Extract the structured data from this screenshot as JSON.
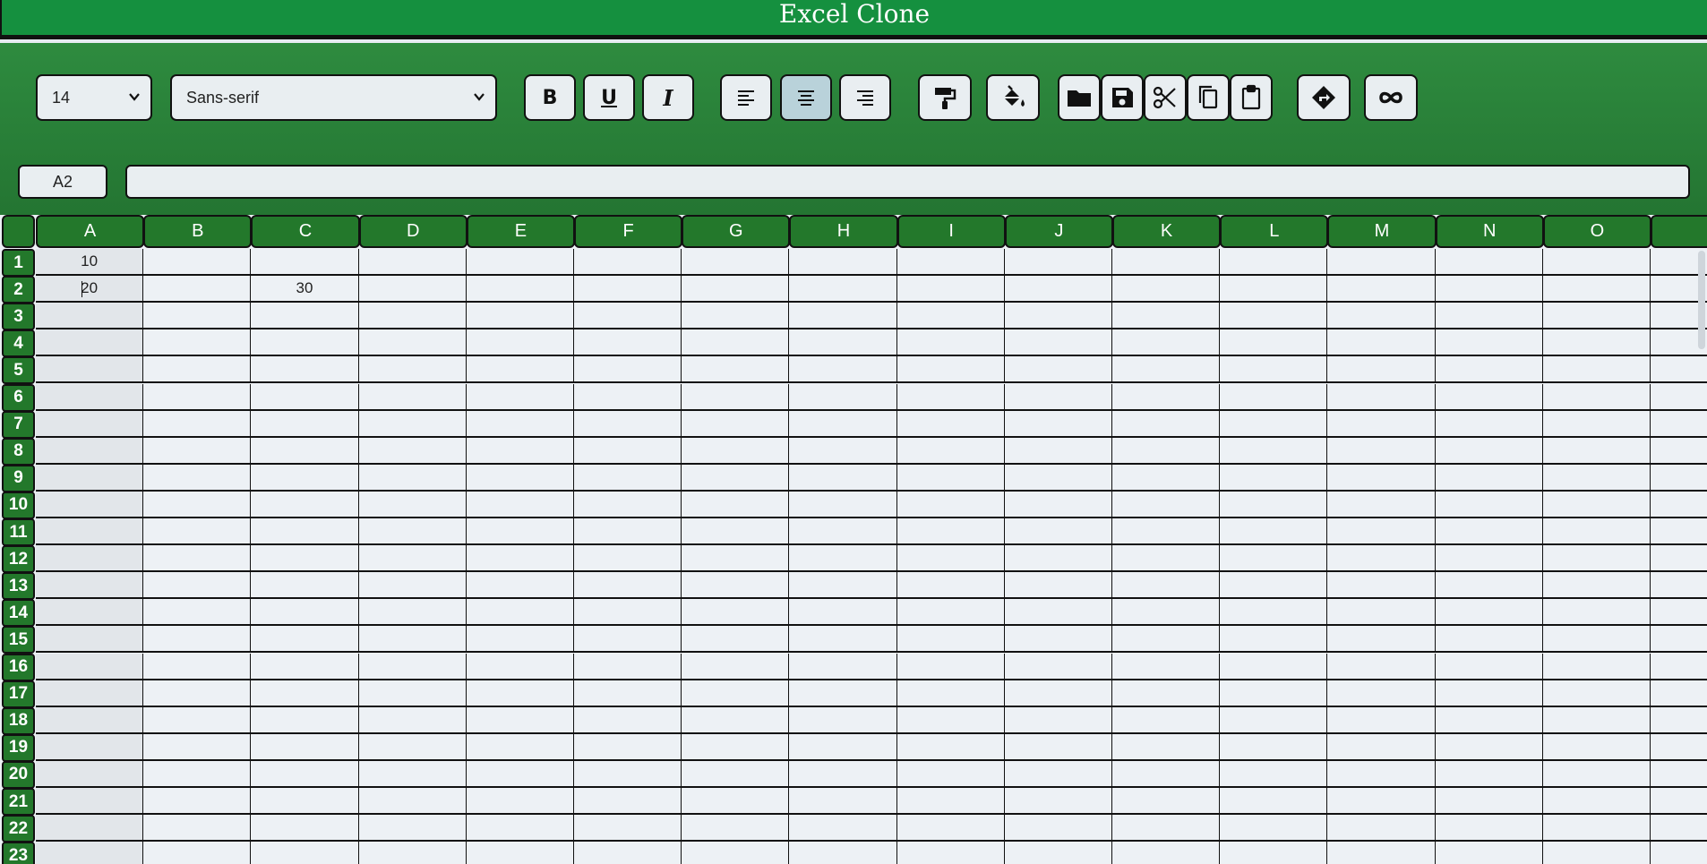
{
  "app": {
    "title": "Excel Clone"
  },
  "toolbar": {
    "font_size": "14",
    "font_family": "Sans-serif",
    "bold_label": "B",
    "underline_label": "U",
    "italic_label": "I",
    "icons": [
      "align-left-icon",
      "align-center-icon",
      "align-right-icon",
      "paint-format-icon",
      "fill-color-icon",
      "open-folder-icon",
      "save-icon",
      "cut-icon",
      "copy-icon",
      "paste-icon",
      "directions-icon",
      "infinity-icon"
    ],
    "active_alignment": "center"
  },
  "formula_bar": {
    "address": "A2",
    "formula": ""
  },
  "sheet": {
    "columns": [
      "A",
      "B",
      "C",
      "D",
      "E",
      "F",
      "G",
      "H",
      "I",
      "J",
      "K",
      "L",
      "M",
      "N",
      "O",
      ""
    ],
    "rows": [
      "1",
      "2",
      "3",
      "4",
      "5",
      "6",
      "7",
      "8",
      "9",
      "10",
      "11",
      "12",
      "13",
      "14",
      "15",
      "16",
      "17",
      "18",
      "19",
      "20",
      "21",
      "22",
      "23"
    ],
    "cells": {
      "A1": "10",
      "A2": "20",
      "C2": "30"
    },
    "selected_cell": "A2"
  },
  "colors": {
    "header_green": "#23782b",
    "title_green": "#15903f",
    "toolbar_green": "#2e8b3f"
  }
}
